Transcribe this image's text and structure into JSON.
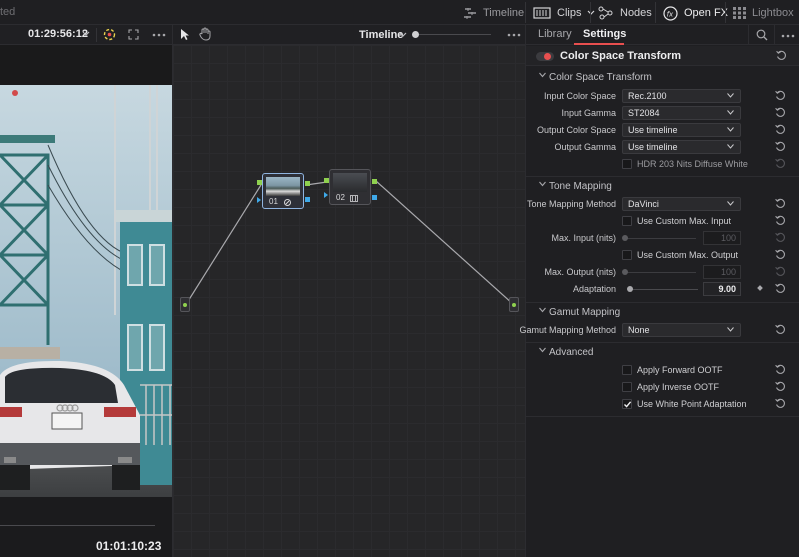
{
  "topbar": {
    "crumb": "ted",
    "timeline_label": "Timeline",
    "clips_label": "Clips",
    "nodes_label": "Nodes",
    "openfx_label": "Open FX",
    "lightbox_label": "Lightbox"
  },
  "viewer": {
    "timecode_top": "01:29:56:12",
    "timecode_bottom": "01:01:10:23"
  },
  "node_editor": {
    "mode_label": "Timeline",
    "nodes": [
      {
        "label": "01"
      },
      {
        "label": "02"
      }
    ]
  },
  "panel": {
    "tabs": {
      "library": "Library",
      "settings": "Settings"
    },
    "fx_title": "Color Space Transform",
    "sections": {
      "cst": "Color Space Transform",
      "tone": "Tone Mapping",
      "gamut": "Gamut Mapping",
      "advanced": "Advanced"
    },
    "cst": {
      "input_color_space_label": "Input Color Space",
      "input_color_space_value": "Rec.2100",
      "input_gamma_label": "Input Gamma",
      "input_gamma_value": "ST2084",
      "output_color_space_label": "Output Color Space",
      "output_color_space_value": "Use timeline",
      "output_gamma_label": "Output Gamma",
      "output_gamma_value": "Use timeline",
      "hdr_diffuse_label": "HDR 203 Nits Diffuse White"
    },
    "tone": {
      "method_label": "Tone Mapping Method",
      "method_value": "DaVinci",
      "custom_max_input_label": "Use Custom Max. Input",
      "max_input_label": "Max. Input (nits)",
      "max_input_value": "100",
      "custom_max_output_label": "Use Custom Max. Output",
      "max_output_label": "Max. Output (nits)",
      "max_output_value": "100",
      "adaptation_label": "Adaptation",
      "adaptation_value": "9.00"
    },
    "gamut": {
      "method_label": "Gamut Mapping Method",
      "method_value": "None"
    },
    "advanced": {
      "forward_ootf_label": "Apply Forward OOTF",
      "inverse_ootf_label": "Apply Inverse OOTF",
      "white_point_label": "Use White Point Adaptation",
      "white_point_checked": true
    }
  },
  "colors": {
    "accent_red": "#e84f4f",
    "port_green": "#8fd14f",
    "port_blue": "#3fa9e8",
    "panel_bg": "#1f1f22"
  }
}
